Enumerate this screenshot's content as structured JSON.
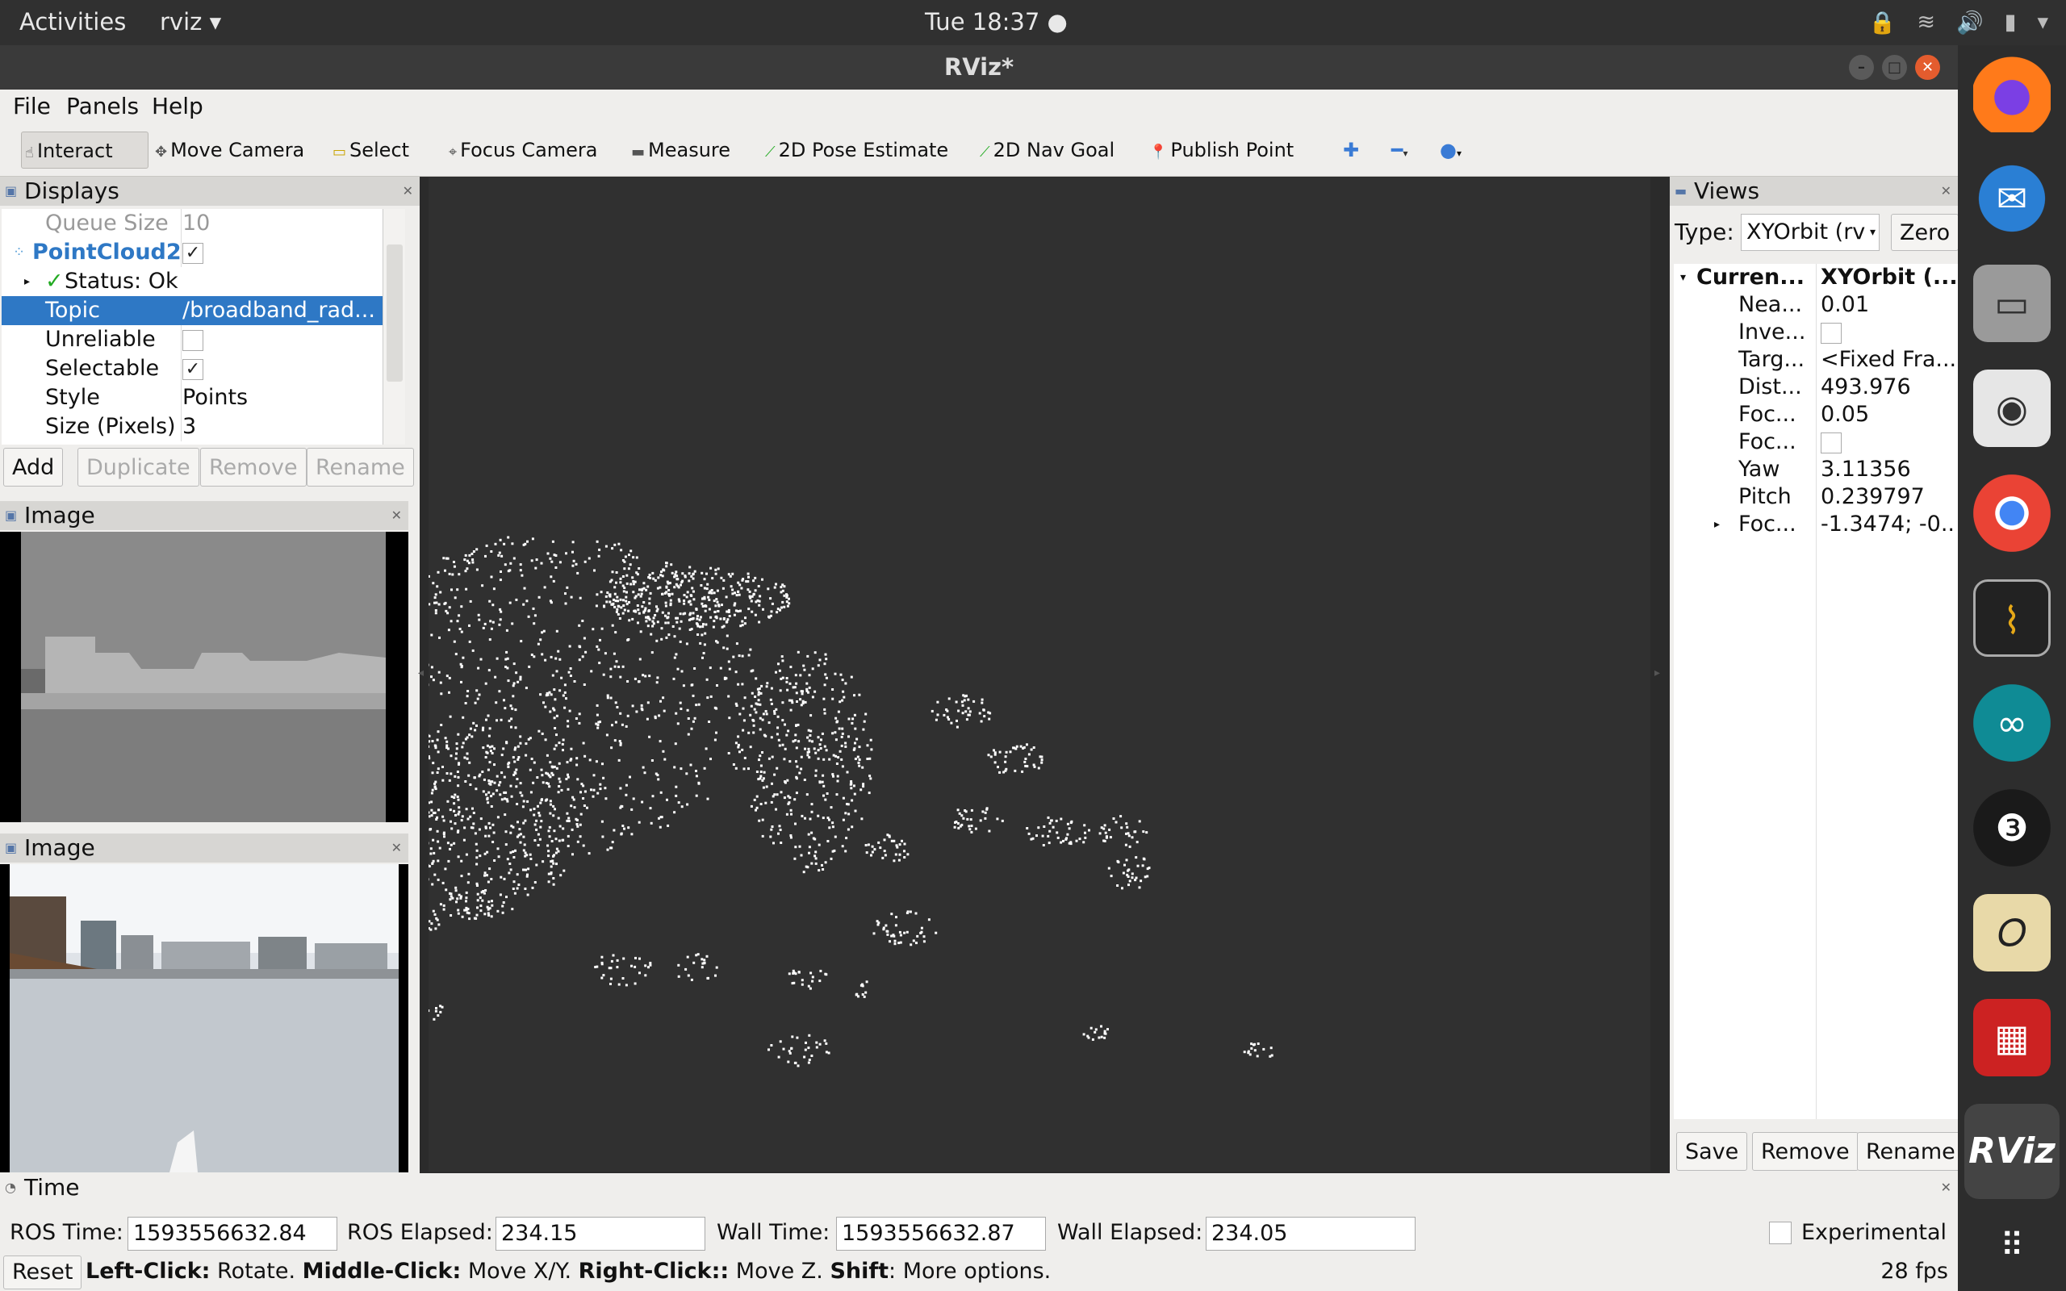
{
  "topbar": {
    "activities": "Activities",
    "app_name": "rviz",
    "clock": "Tue 18:37 ●"
  },
  "window": {
    "title": "RViz*"
  },
  "menu": {
    "file": "File",
    "panels": "Panels",
    "help": "Help"
  },
  "toolbar": {
    "interact": "Interact",
    "move_camera": "Move Camera",
    "select": "Select",
    "focus_camera": "Focus Camera",
    "measure": "Measure",
    "pose_estimate": "2D Pose Estimate",
    "nav_goal": "2D Nav Goal",
    "publish_point": "Publish Point"
  },
  "displays": {
    "title": "Displays",
    "rows": {
      "queue_size": {
        "key": "Queue Size",
        "value": "10"
      },
      "pointcloud": {
        "key": "PointCloud2"
      },
      "status": {
        "key": "Status: Ok"
      },
      "topic": {
        "key": "Topic",
        "value": "/broadband_rad..."
      },
      "unreliable": {
        "key": "Unreliable"
      },
      "selectable": {
        "key": "Selectable"
      },
      "style": {
        "key": "Style",
        "value": "Points"
      },
      "size": {
        "key": "Size (Pixels)",
        "value": "3"
      }
    },
    "buttons": {
      "add": "Add",
      "duplicate": "Duplicate",
      "remove": "Remove",
      "rename": "Rename"
    }
  },
  "image_panels": {
    "title1": "Image",
    "title2": "Image"
  },
  "views": {
    "title": "Views",
    "type_label": "Type:",
    "type_value": "XYOrbit (rv",
    "zero": "Zero",
    "current": {
      "key": "Curren...",
      "value": "XYOrbit (..."
    },
    "props": {
      "near": {
        "key": "Nea...",
        "value": "0.01"
      },
      "invert": {
        "key": "Inve...",
        "value": ""
      },
      "target": {
        "key": "Targ...",
        "value": "<Fixed Fra..."
      },
      "distance": {
        "key": "Dist...",
        "value": "493.976"
      },
      "focal_size": {
        "key": "Foc...",
        "value": "0.05"
      },
      "focal_shape": {
        "key": "Foc...",
        "value": ""
      },
      "yaw": {
        "key": "Yaw",
        "value": "3.11356"
      },
      "pitch": {
        "key": "Pitch",
        "value": "0.239797"
      },
      "focal_point": {
        "key": "Foc...",
        "value": "-1.3474; -0..."
      }
    },
    "buttons": {
      "save": "Save",
      "remove": "Remove",
      "rename": "Rename"
    }
  },
  "time": {
    "title": "Time",
    "ros_time_label": "ROS Time:",
    "ros_time": "1593556632.84",
    "ros_elapsed_label": "ROS Elapsed:",
    "ros_elapsed": "234.15",
    "wall_time_label": "Wall Time:",
    "wall_time": "1593556632.87",
    "wall_elapsed_label": "Wall Elapsed:",
    "wall_elapsed": "234.05",
    "experimental": "Experimental"
  },
  "statusbar": {
    "reset": "Reset",
    "left_click": "Left-Click:",
    "rotate": " Rotate. ",
    "middle_click": "Middle-Click:",
    "move_xy": " Move X/Y. ",
    "right_click": "Right-Click::",
    "move_z": " Move Z. ",
    "shift": "Shift",
    "more": ": More options.",
    "fps": "28 fps"
  },
  "dock": {
    "rviz_label": "RViz"
  },
  "colors": {
    "selection": "#2e78c5",
    "viewport": "#303030",
    "topbar": "#303030"
  }
}
